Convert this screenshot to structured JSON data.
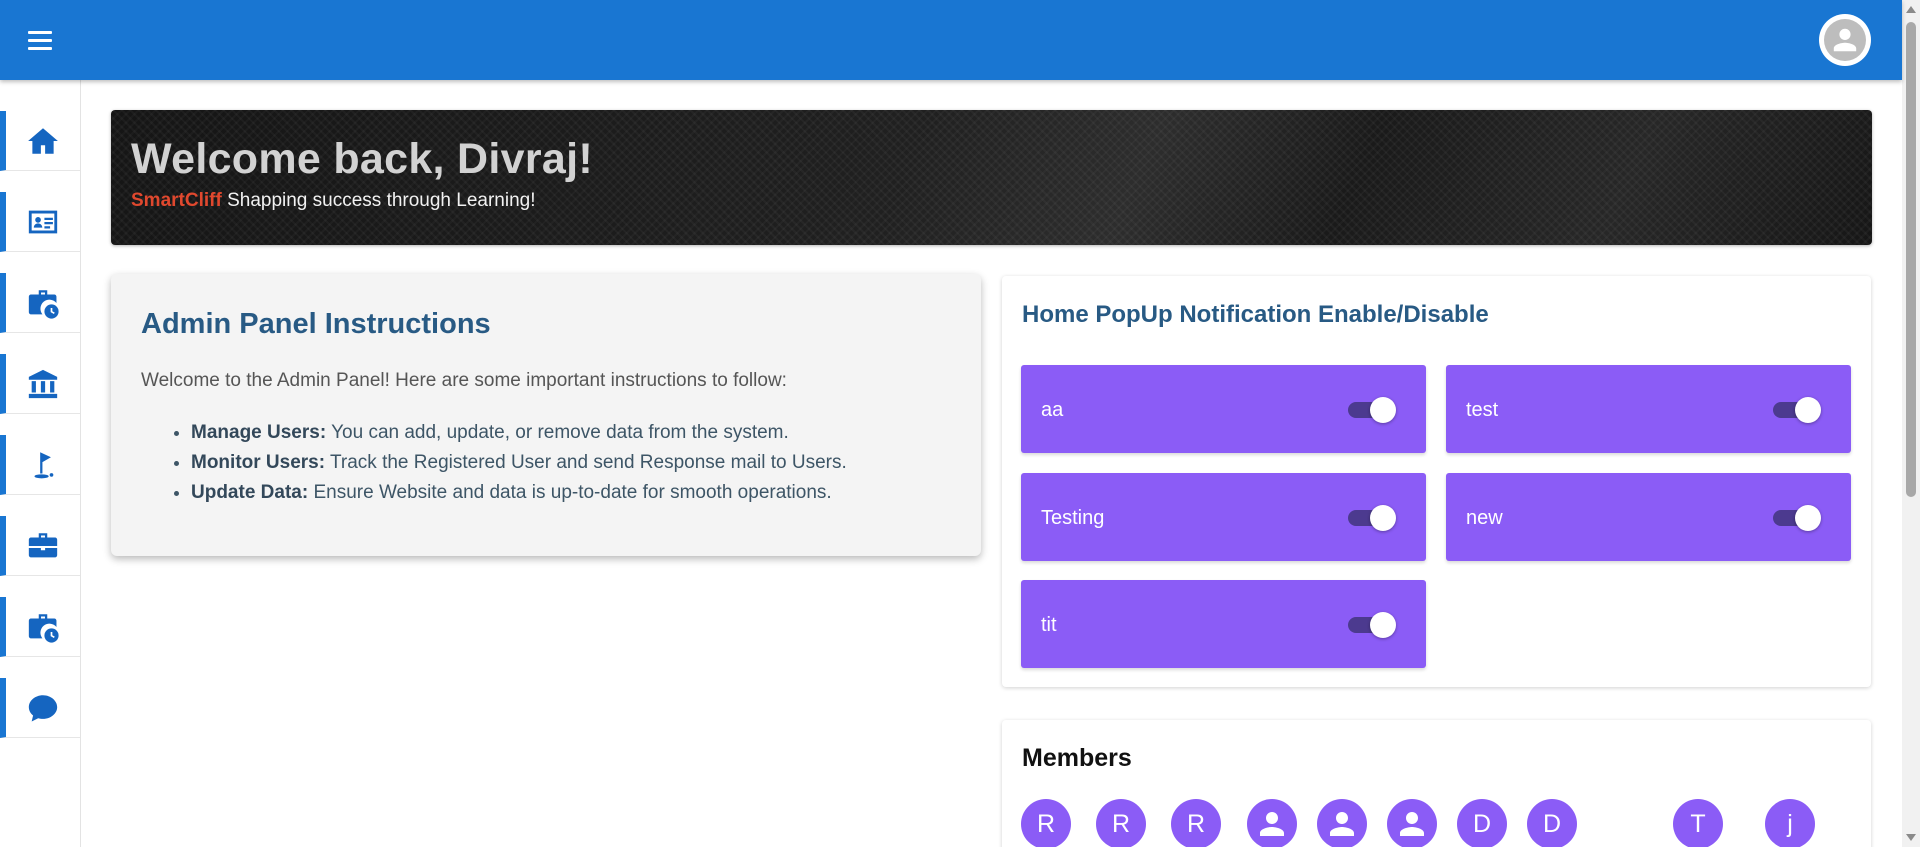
{
  "appbar": {
    "menu_icon": "menu-icon",
    "account_icon": "account-circle-icon",
    "color": "#1976d2"
  },
  "sidebar": {
    "items": [
      {
        "icon": "home-icon"
      },
      {
        "icon": "id-card-icon"
      },
      {
        "icon": "briefcase-clock-icon"
      },
      {
        "icon": "bank-icon"
      },
      {
        "icon": "golf-flag-icon"
      },
      {
        "icon": "briefcase-icon"
      },
      {
        "icon": "briefcase-clock-icon"
      },
      {
        "icon": "chat-bubble-icon"
      }
    ]
  },
  "banner": {
    "title": "Welcome back, Divraj!",
    "brand": "SmartCliff",
    "tagline": " Shapping success through Learning!"
  },
  "instructions": {
    "title": "Admin Panel Instructions",
    "intro": "Welcome to the Admin Panel! Here are some important instructions to follow:",
    "items": [
      {
        "label": "Manage Users:",
        "text": " You can add, update, or remove data from the system."
      },
      {
        "label": "Monitor Users:",
        "text": " Track the Registered User and send Response mail to Users."
      },
      {
        "label": "Update Data:",
        "text": " Ensure Website and data is up-to-date for smooth operations."
      }
    ]
  },
  "notifications": {
    "title": "Home PopUp Notification Enable/Disable",
    "tile_color": "#8b5cf6",
    "items": [
      {
        "label": "aa",
        "enabled": true
      },
      {
        "label": "test",
        "enabled": true
      },
      {
        "label": "Testing",
        "enabled": true
      },
      {
        "label": "new",
        "enabled": true
      },
      {
        "label": "tit",
        "enabled": true
      }
    ]
  },
  "members": {
    "title": "Members",
    "avatar_color": "#8b5cf6",
    "items": [
      {
        "initial": "R"
      },
      {
        "initial": "R"
      },
      {
        "initial": "R"
      },
      {
        "icon": "person-icon"
      },
      {
        "icon": "person-icon"
      },
      {
        "icon": "person-icon"
      },
      {
        "initial": "D"
      },
      {
        "initial": "D"
      },
      {
        "initial": "T"
      },
      {
        "initial": "j"
      }
    ]
  }
}
